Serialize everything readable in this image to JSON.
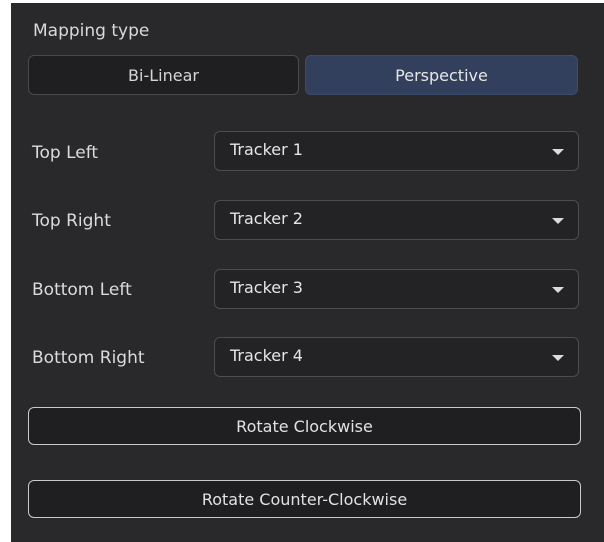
{
  "mapping": {
    "title": "Mapping type",
    "options": [
      "Bi-Linear",
      "Perspective"
    ],
    "selected": "Perspective"
  },
  "corners": [
    {
      "label": "Top Left",
      "value": "Tracker 1"
    },
    {
      "label": "Top Right",
      "value": "Tracker 2"
    },
    {
      "label": "Bottom Left",
      "value": "Tracker 3"
    },
    {
      "label": "Bottom Right",
      "value": "Tracker 4"
    }
  ],
  "buttons": {
    "rotate_cw": "Rotate Clockwise",
    "rotate_ccw": "Rotate Counter-Clockwise"
  },
  "colors": {
    "panel_bg": "#29292b",
    "selected_segment": "#323f5d",
    "control_bg": "#232325",
    "text": "#e2e2e2"
  },
  "icons": {
    "dropdown": "chevron-down-icon"
  }
}
